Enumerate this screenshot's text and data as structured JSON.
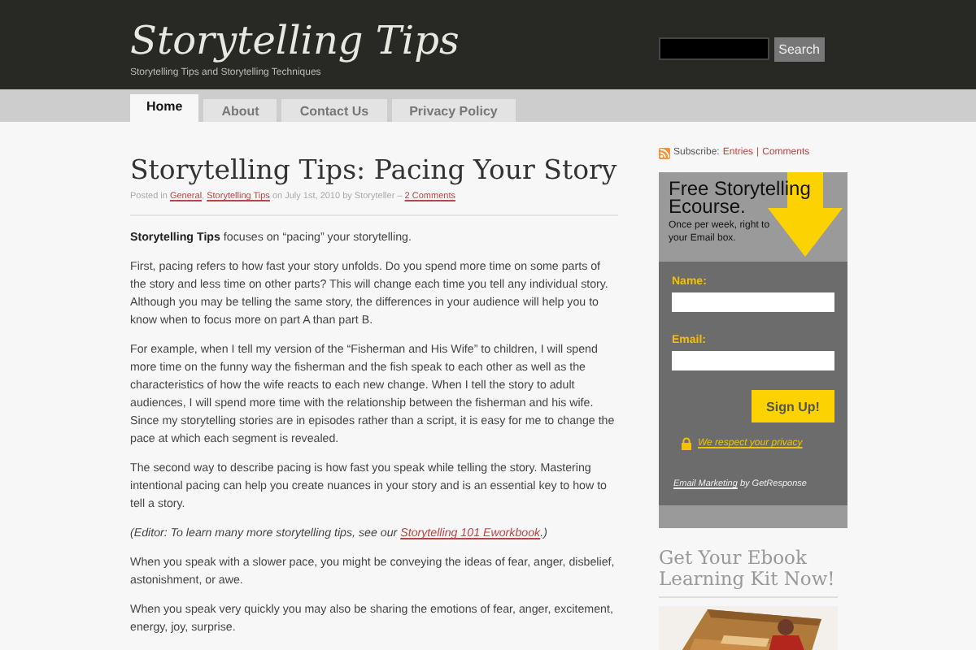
{
  "header": {
    "site_title": "Storytelling Tips",
    "tagline": "Storytelling Tips and Storytelling Techniques",
    "search_button": "Search"
  },
  "nav": [
    {
      "label": "Home",
      "selected": true
    },
    {
      "label": "About",
      "selected": false
    },
    {
      "label": "Contact Us",
      "selected": false
    },
    {
      "label": "Privacy Policy",
      "selected": false
    }
  ],
  "post": {
    "title": "Storytelling Tips: Pacing Your Story",
    "meta": [
      {
        "kind": "text",
        "text": "Posted in "
      },
      {
        "kind": "link",
        "text": "General"
      },
      {
        "kind": "text",
        "text": ", "
      },
      {
        "kind": "link",
        "text": "Storytelling Tips"
      },
      {
        "kind": "text",
        "text": " on July 1st, 2010 by Storyteller – "
      },
      {
        "kind": "link",
        "text": "2 Comments"
      }
    ],
    "paragraphs": [
      {
        "kind": "plain",
        "parts": [
          {
            "kind": "text",
            "text": "**Storytelling Tips** focuses on “pacing” your storytelling."
          }
        ]
      },
      {
        "kind": "plain",
        "parts": [
          {
            "kind": "text",
            "text": "First, pacing refers to how fast your story unfolds. Do you spend more time on some parts of the story and less time on other parts? This will change each time you tell any individual story. Although you may be telling the same story, the differences in your audience will help you to know when to focus more on part A than part B."
          }
        ]
      },
      {
        "kind": "plain",
        "parts": [
          {
            "kind": "text",
            "text": "For example, when I tell my version of the “Fisherman and His Wife” to children, I will spend more time on the funny way the fisherman and the fish speak to each other as well as the characteristics of how the wife reacts to each new change. When I tell the story to adult audiences, I will spend more time with the relationship between the fisherman and his wife. Since my storytelling stories are in episodes rather than a script, it is easy for me to change the pace at which each segment is revealed."
          }
        ]
      },
      {
        "kind": "plain",
        "parts": [
          {
            "kind": "text",
            "text": "The second way to describe pacing is how fast you speak while telling the story. Mastering intentional pacing can help you create nuances in your story and is an essential key to how to tell a story."
          }
        ]
      },
      {
        "kind": "editor",
        "parts": [
          {
            "kind": "text",
            "text": "(Editor: To learn many more storytelling tips, see our "
          },
          {
            "kind": "link",
            "text": "Storytelling 101 Eworkbook"
          },
          {
            "kind": "text",
            "text": ".)"
          }
        ]
      },
      {
        "kind": "plain",
        "parts": [
          {
            "kind": "text",
            "text": "When you speak with a slower pace, you might be conveying the ideas of fear, anger, disbelief, astonishment, or awe."
          }
        ]
      },
      {
        "kind": "plain",
        "parts": [
          {
            "kind": "text",
            "text": "When you speak very quickly you may also be sharing the emotions of fear, anger, excitement, energy, joy, surprise."
          }
        ]
      }
    ]
  },
  "sidebar": {
    "subscribe": {
      "label": "Subscribe:",
      "links": [
        "Entries",
        "Comments"
      ],
      "separator": "|"
    },
    "optin": {
      "title": "Free Storytelling Ecourse.",
      "subtitle": "Once per week, right to your Email box.",
      "name_label": "Name:",
      "email_label": "Email:",
      "button": "Sign Up!",
      "privacy": "We respect your privacy",
      "footer": [
        {
          "kind": "link",
          "text": "Email Marketing"
        },
        {
          "kind": "text",
          "text": " by GetResponse"
        }
      ]
    },
    "ebook": {
      "title": "Get Your Ebook Learning Kit Now!"
    }
  }
}
